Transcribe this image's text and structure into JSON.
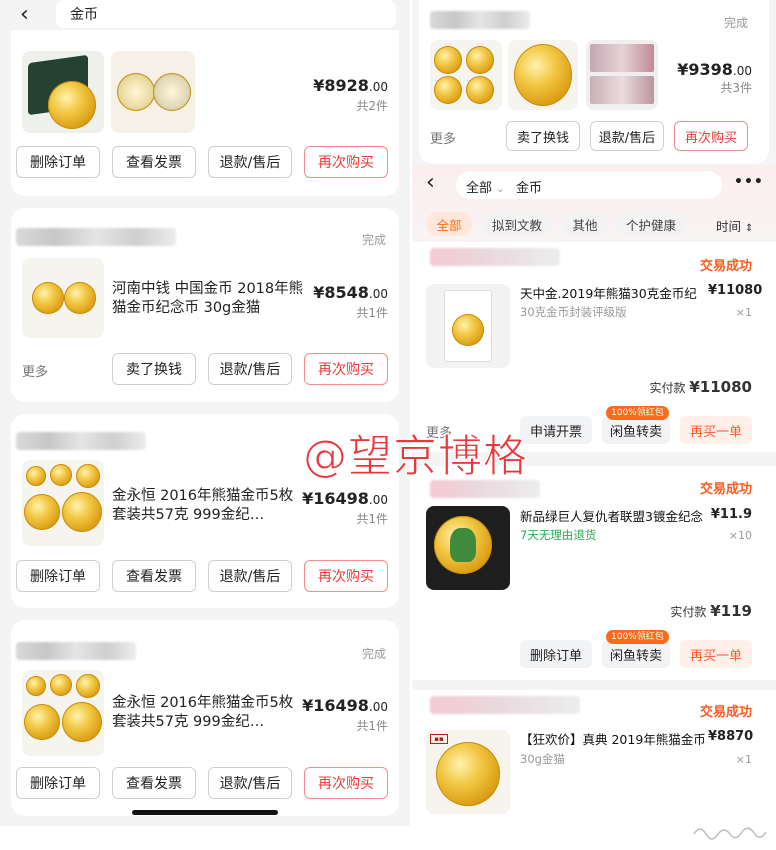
{
  "left": {
    "header": {
      "title": "金币"
    },
    "order1": {
      "price_main": "¥8928",
      "price_cents": ".00",
      "count": "共2件",
      "buttons": [
        "删除订单",
        "查看发票",
        "退款/售后",
        "再次购买"
      ]
    },
    "order2": {
      "status": "完成",
      "title": "河南中钱 中国金币 2018年熊猫金币纪念币 30g金猫",
      "price_main": "¥8548",
      "price_cents": ".00",
      "count": "共1件",
      "more": "更多",
      "buttons": [
        "卖了换钱",
        "退款/售后",
        "再次购买"
      ]
    },
    "order3": {
      "title": "金永恒 2016年熊猫金币5枚套装共57克 999金纪…",
      "price_main": "¥16498",
      "price_cents": ".00",
      "count": "共1件",
      "buttons": [
        "删除订单",
        "查看发票",
        "退款/售后",
        "再次购买"
      ]
    },
    "order4": {
      "status": "完成",
      "title": "金永恒 2016年熊猫金币5枚套装共57克 999金纪…",
      "price_main": "¥16498",
      "price_cents": ".00",
      "count": "共1件",
      "buttons": [
        "删除订单",
        "查看发票",
        "退款/售后",
        "再次购买"
      ]
    }
  },
  "right_top": {
    "status": "完成",
    "price_main": "¥9398",
    "price_cents": ".00",
    "count": "共3件",
    "more": "更多",
    "buttons": [
      "卖了换钱",
      "退款/售后",
      "再次购买"
    ]
  },
  "right": {
    "filter": {
      "scope": "全部",
      "keyword": "金币",
      "menu_icon": "•••"
    },
    "tabs": [
      "全部",
      "拟到文教",
      "其他",
      "个护健康"
    ],
    "sort_label": "时间",
    "orders": [
      {
        "status": "交易成功",
        "title": "天中金.2019年熊猫30克金币纪",
        "sub": "30克金币封装评级版",
        "price": "¥11080",
        "count": "×1",
        "paid_label": "实付款",
        "paid": "¥11080",
        "more": "更多",
        "buttons": [
          "申请开票",
          "闲鱼转卖",
          "再买一单"
        ],
        "badge": "100%领红包"
      },
      {
        "status": "交易成功",
        "title": "新品绿巨人复仇者联盟3镀金纪念",
        "sub": "7天无理由退货",
        "price": "¥11.9",
        "count": "×10",
        "paid_label": "实付款",
        "paid": "¥119",
        "buttons": [
          "删除订单",
          "闲鱼转卖",
          "再买一单"
        ],
        "badge": "100%领红包"
      },
      {
        "status": "交易成功",
        "title": "【狂欢价】真典 2019年熊猫金币",
        "sub": "30g金猫",
        "price": "¥8870",
        "count": "×1"
      }
    ]
  },
  "watermark": "@望京博格",
  "colors": {
    "accent": "#ee3a3a",
    "orange": "#ff5a1f",
    "bg": "#f4f4f4"
  }
}
